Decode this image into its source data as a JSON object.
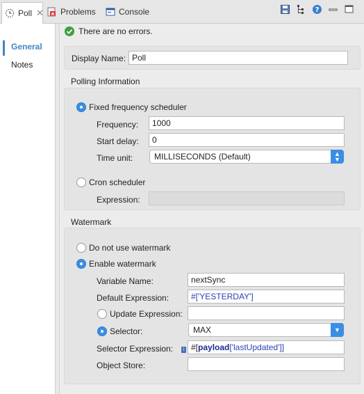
{
  "tabs": [
    {
      "label": "Poll",
      "icon": "clock-icon"
    },
    {
      "label": "Problems",
      "icon": "problems-icon"
    },
    {
      "label": "Console",
      "icon": "console-icon"
    }
  ],
  "toolbar_icons": [
    "save-icon",
    "tree-icon",
    "help-icon",
    "minimize-icon",
    "maximize-icon"
  ],
  "sidebar": {
    "items": [
      {
        "label": "General"
      },
      {
        "label": "Notes"
      }
    ]
  },
  "status": {
    "text": "There are no errors."
  },
  "display_name": {
    "label": "Display Name:",
    "value": "Poll"
  },
  "polling": {
    "title": "Polling Information",
    "fixed_label": "Fixed frequency scheduler",
    "frequency_label": "Frequency:",
    "frequency_value": "1000",
    "start_delay_label": "Start delay:",
    "start_delay_value": "0",
    "time_unit_label": "Time unit:",
    "time_unit_value": "MILLISECONDS (Default)",
    "cron_label": "Cron scheduler",
    "expression_label": "Expression:",
    "expression_value": ""
  },
  "watermark": {
    "title": "Watermark",
    "no_watermark_label": "Do not use watermark",
    "enable_label": "Enable watermark",
    "variable_name_label": "Variable Name:",
    "variable_name_value": "nextSync",
    "default_expression_label": "Default Expression:",
    "default_expression_value": "#['YESTERDAY']",
    "update_expression_label": "Update Expression:",
    "update_expression_value": "",
    "selector_label": "Selector:",
    "selector_value": "MAX",
    "selector_expression_label": "Selector Expression:",
    "selector_expression_prefix": "#[",
    "selector_expression_keyword": "payload",
    "selector_expression_rest": "['lastUpdated']]",
    "object_store_label": "Object Store:",
    "object_store_value": ""
  },
  "colors": {
    "accent": "#3a8ee6",
    "ok": "#3fa03f",
    "sidebar_active": "#3f86c4"
  }
}
